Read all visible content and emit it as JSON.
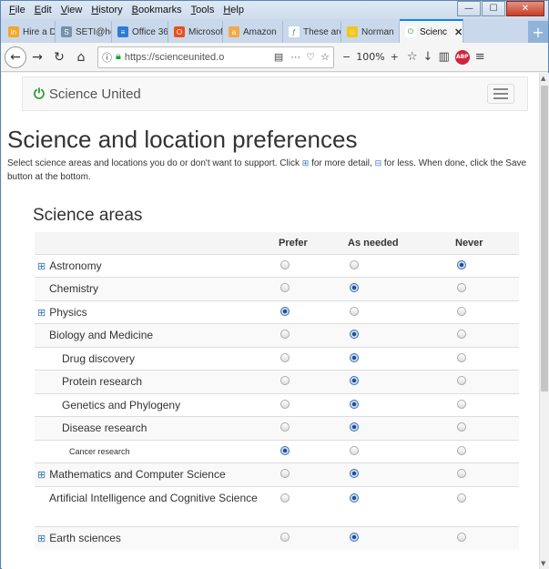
{
  "menubar": {
    "items": [
      {
        "label": "File"
      },
      {
        "label": "Edit"
      },
      {
        "label": "View"
      },
      {
        "label": "History"
      },
      {
        "label": "Bookmarks"
      },
      {
        "label": "Tools"
      },
      {
        "label": "Help"
      }
    ]
  },
  "window_controls": {
    "minimize": "—",
    "maximize": "☐",
    "close": "✕"
  },
  "tabs": [
    {
      "label": "Hire a De",
      "icon_color": "#f5a623",
      "icon_glyph": "in"
    },
    {
      "label": "SETI@ho",
      "icon_color": "#7a8fa8",
      "icon_glyph": "S"
    },
    {
      "label": "Office 36",
      "icon_color": "#2b7cd3",
      "icon_glyph": "≡"
    },
    {
      "label": "Microsoft",
      "icon_color": "#e8501c",
      "icon_glyph": "O"
    },
    {
      "label": "Amazon",
      "icon_color": "#f3a847",
      "icon_glyph": "a"
    },
    {
      "label": "These are",
      "icon_color": "#ffffff",
      "icon_glyph": "ƒ"
    },
    {
      "label": "Norman",
      "icon_color": "#f5c518",
      "icon_glyph": "☺"
    },
    {
      "label": "Scienc",
      "icon_color": "#ffffff",
      "icon_glyph": "⏻",
      "active": true
    }
  ],
  "navbar": {
    "url": "https://scienceunited.o",
    "zoom": "100%"
  },
  "site": {
    "brand": "Science United"
  },
  "page": {
    "title": "Science and location preferences",
    "intro_part1": "Select science areas and locations you do or don't want to support. Click",
    "intro_part2": "for more detail,",
    "intro_part3": "for less. When done, click the Save button at the bottom.",
    "section_title": "Science areas"
  },
  "table": {
    "headers": {
      "name": "",
      "prefer": "Prefer",
      "as_needed": "As needed",
      "never": "Never"
    },
    "rows": [
      {
        "name": "Astronomy",
        "level": 0,
        "expander": true,
        "selected": "never"
      },
      {
        "name": "Chemistry",
        "level": 1,
        "expander": false,
        "selected": "as_needed"
      },
      {
        "name": "Physics",
        "level": 0,
        "expander": true,
        "selected": "prefer"
      },
      {
        "name": "Biology and Medicine",
        "level": 1,
        "expander": false,
        "selected": "as_needed"
      },
      {
        "name": "Drug discovery",
        "level": 2,
        "expander": false,
        "selected": "as_needed"
      },
      {
        "name": "Protein research",
        "level": 2,
        "expander": false,
        "selected": "as_needed"
      },
      {
        "name": "Genetics and Phylogeny",
        "level": 2,
        "expander": false,
        "selected": "as_needed"
      },
      {
        "name": "Disease research",
        "level": 2,
        "expander": false,
        "selected": "as_needed"
      },
      {
        "name": "Cancer research",
        "level": 3,
        "expander": false,
        "selected": "prefer"
      },
      {
        "name": "Mathematics and Computer Science",
        "level": 0,
        "expander": true,
        "selected": "as_needed"
      },
      {
        "name": "Artificial Intelligence and Cognitive Science",
        "level": 1,
        "expander": false,
        "selected": "as_needed",
        "tall": true
      },
      {
        "name": "Earth sciences",
        "level": 0,
        "expander": true,
        "selected": "as_needed"
      }
    ]
  },
  "colors": {
    "brand_green": "#2a9a2a",
    "link_blue": "#337ab7",
    "active_tab_accent": "#0a84ff",
    "radio_selected": "#1e4f9a"
  },
  "icons": {
    "expander": "plus-square-icon",
    "collapse": "minus-square-icon",
    "brand": "power-icon"
  }
}
